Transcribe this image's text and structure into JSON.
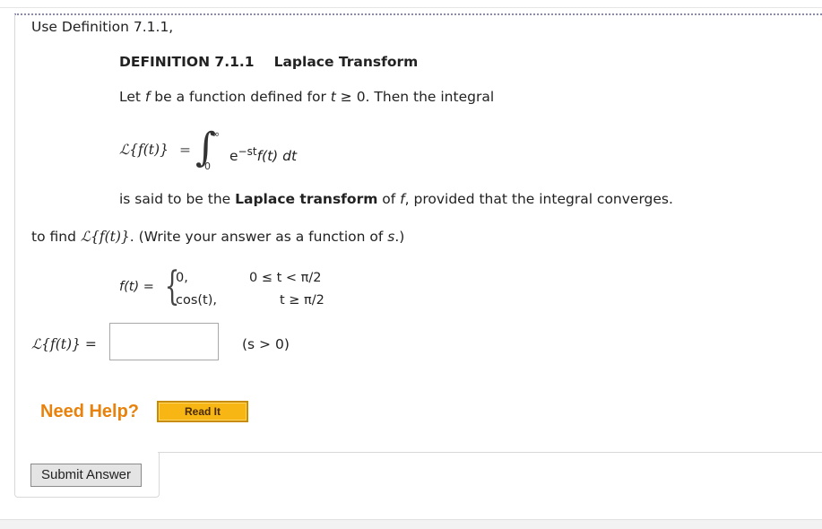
{
  "intro": "Use Definition 7.1.1,",
  "definition": {
    "number": "DEFINITION 7.1.1",
    "title": "Laplace Transform",
    "line1_prefix": "Let ",
    "line1_f": "f",
    "line1_mid": " be a function defined for ",
    "line1_t": "t",
    "line1_suffix": " ≥ 0. Then the integral",
    "lhs": "ℒ{f(t)}",
    "lhs_eq": "=",
    "integral_sign": "∫",
    "upper_limit": "∞",
    "lower_limit": "0",
    "integrand_e": "e",
    "integrand_exp": "−st",
    "integrand_rest": "f(t) dt",
    "line3_prefix": "is said to be the ",
    "line3_bold": "Laplace transform",
    "line3_mid": " of ",
    "line3_f": "f",
    "line3_suffix": ", provided that the integral converges."
  },
  "task": {
    "prefix": "to find ",
    "expr": "ℒ{f(t)}",
    "suffix": ". (Write your answer as a function of ",
    "var": "s",
    "end": ".)"
  },
  "piecewise": {
    "lhs": "f(t) =",
    "brace": "{",
    "case1_value": "0,",
    "case1_condition": "0 ≤ t < π/2",
    "case2_value": "cos(t),",
    "case2_condition": "t ≥ π/2"
  },
  "answer": {
    "label": "ℒ{f(t)} =",
    "value": "",
    "placeholder": "",
    "condition": "(s > 0)"
  },
  "help": {
    "label": "Need Help?",
    "read_it": "Read It"
  },
  "submit": {
    "label": "Submit Answer"
  },
  "colors": {
    "need_help": "#e8820c",
    "read_it_bg": "#f7b614",
    "read_it_border": "#c98b00"
  }
}
